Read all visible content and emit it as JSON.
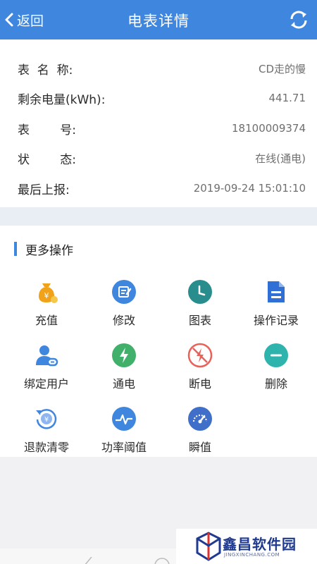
{
  "header": {
    "back_label": "返回",
    "title": "电表详情",
    "refresh_icon": "refresh-icon"
  },
  "details": [
    {
      "label": "表  名  称:",
      "value": "CD走的慢"
    },
    {
      "label": "剩余电量(kWh):",
      "value": "441.71"
    },
    {
      "label": "表        号:",
      "value": "18100009374"
    },
    {
      "label": "状        态:",
      "value": "在线(通电)"
    },
    {
      "label": "最后上报:",
      "value": "2019-09-24 15:01:10"
    }
  ],
  "more": {
    "title": "更多操作",
    "items": [
      {
        "label": "充值",
        "icon": "money-bag-icon",
        "color": "#f0a21a"
      },
      {
        "label": "修改",
        "icon": "edit-icon",
        "color": "#3f86df"
      },
      {
        "label": "图表",
        "icon": "clock-icon",
        "color": "#2a8d8d"
      },
      {
        "label": "操作记录",
        "icon": "document-icon",
        "color": "#2f6fd6"
      },
      {
        "label": "绑定用户",
        "icon": "user-link-icon",
        "color": "#3f86df"
      },
      {
        "label": "通电",
        "icon": "power-on-icon",
        "color": "#40b06a"
      },
      {
        "label": "断电",
        "icon": "power-off-icon",
        "color": "#e8625a"
      },
      {
        "label": "删除",
        "icon": "minus-icon",
        "color": "#2fb3ad"
      },
      {
        "label": "退款清零",
        "icon": "refund-icon",
        "color": "#3f86df"
      },
      {
        "label": "功率阈值",
        "icon": "power-threshold-icon",
        "color": "#3f86df"
      },
      {
        "label": "瞬值",
        "icon": "gauge-icon",
        "color": "#3f6fc9"
      }
    ]
  },
  "watermark": {
    "title": "鑫昌软件园",
    "subtitle": "JINGXINCHANG.COM"
  }
}
